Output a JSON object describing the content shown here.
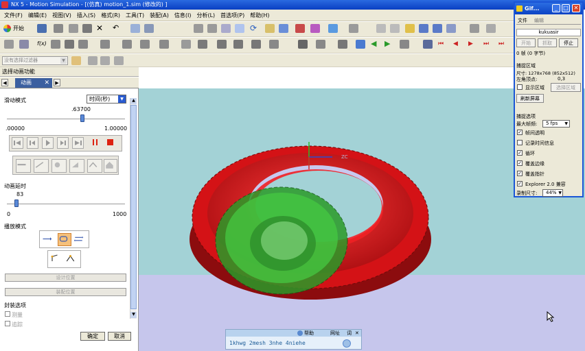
{
  "window": {
    "title": "NX 5 - Motion Simulation - [(仿真) motion_1.sim (修改的) ]"
  },
  "menu": {
    "items": [
      "文件(F)",
      "编辑(E)",
      "视图(V)",
      "插入(S)",
      "格式(R)",
      "工具(T)",
      "装配(A)",
      "信息(I)",
      "分析(L)",
      "首选项(P)",
      "帮助(H)"
    ]
  },
  "toolbar": {
    "start_label": "开始",
    "filter_value": "没有选择过滤器"
  },
  "dynamic_caption": "选择动画功能",
  "tab": {
    "label": "动画"
  },
  "panel": {
    "slide_mode_label": "滑动模式",
    "slide_mode_value": "时间(秒)",
    "time_value": ".63700",
    "time_min": ".00000",
    "time_max": "1.00000",
    "time_fraction": 0.637,
    "delay_label": "动画延时",
    "delay_value": "83",
    "delay_min": "0",
    "delay_max": "1000",
    "delay_fraction": 0.083,
    "play_mode_label": "播放模式",
    "btn_design_pos": "设计位置",
    "btn_assembly_pos": "装配位置",
    "package_label": "封装选项",
    "package_opt1": "测量",
    "package_opt2": "追踪",
    "ok_label": "确定",
    "cancel_label": "取消"
  },
  "viewport": {
    "axis_label": "ZC"
  },
  "gif_window": {
    "title": "Gif...",
    "menu_file": "文件",
    "menu_edit": "编辑",
    "user": "kukuasir",
    "btn_start": "开始",
    "btn_capture": "抓取",
    "btn_stop": "停止",
    "frames": "0 帧 (0 字节)",
    "capture_area_label": "捕捉区域",
    "size_label": "尺寸: 1278x768 (852x512)",
    "corner_label": "左角顶点:",
    "corner_value": "0,3",
    "show_area_label": "显示区域",
    "select_area_btn": "选择区域",
    "refresh_btn": "刷新屏幕",
    "capture_opts_label": "捕捉选项",
    "max_fps_label": "最大帧频:",
    "max_fps_value": "5 fps",
    "opt_transparent": "帧间透明",
    "opt_timing": "记录时间信息",
    "opt_loop": "循环",
    "opt_cover_edge": "覆盖边缘",
    "opt_cover_cursor": "覆盖指针",
    "opt_explorer": "Explorer 2.0 兼容",
    "record_size_label": "录制尺寸:",
    "record_size_value": "44%"
  },
  "ime": {
    "label_help": "帮助",
    "label_web": "网址",
    "label_word": "词",
    "text": "1khwg 2mesh 3nhe 4niehe"
  },
  "colors": {
    "titlebar": "#0a3fc2",
    "gear_red": "#e8141c",
    "gear_green": "#3ec83a",
    "sky": "#a3d2d6",
    "floor": "#c6c6ec"
  }
}
